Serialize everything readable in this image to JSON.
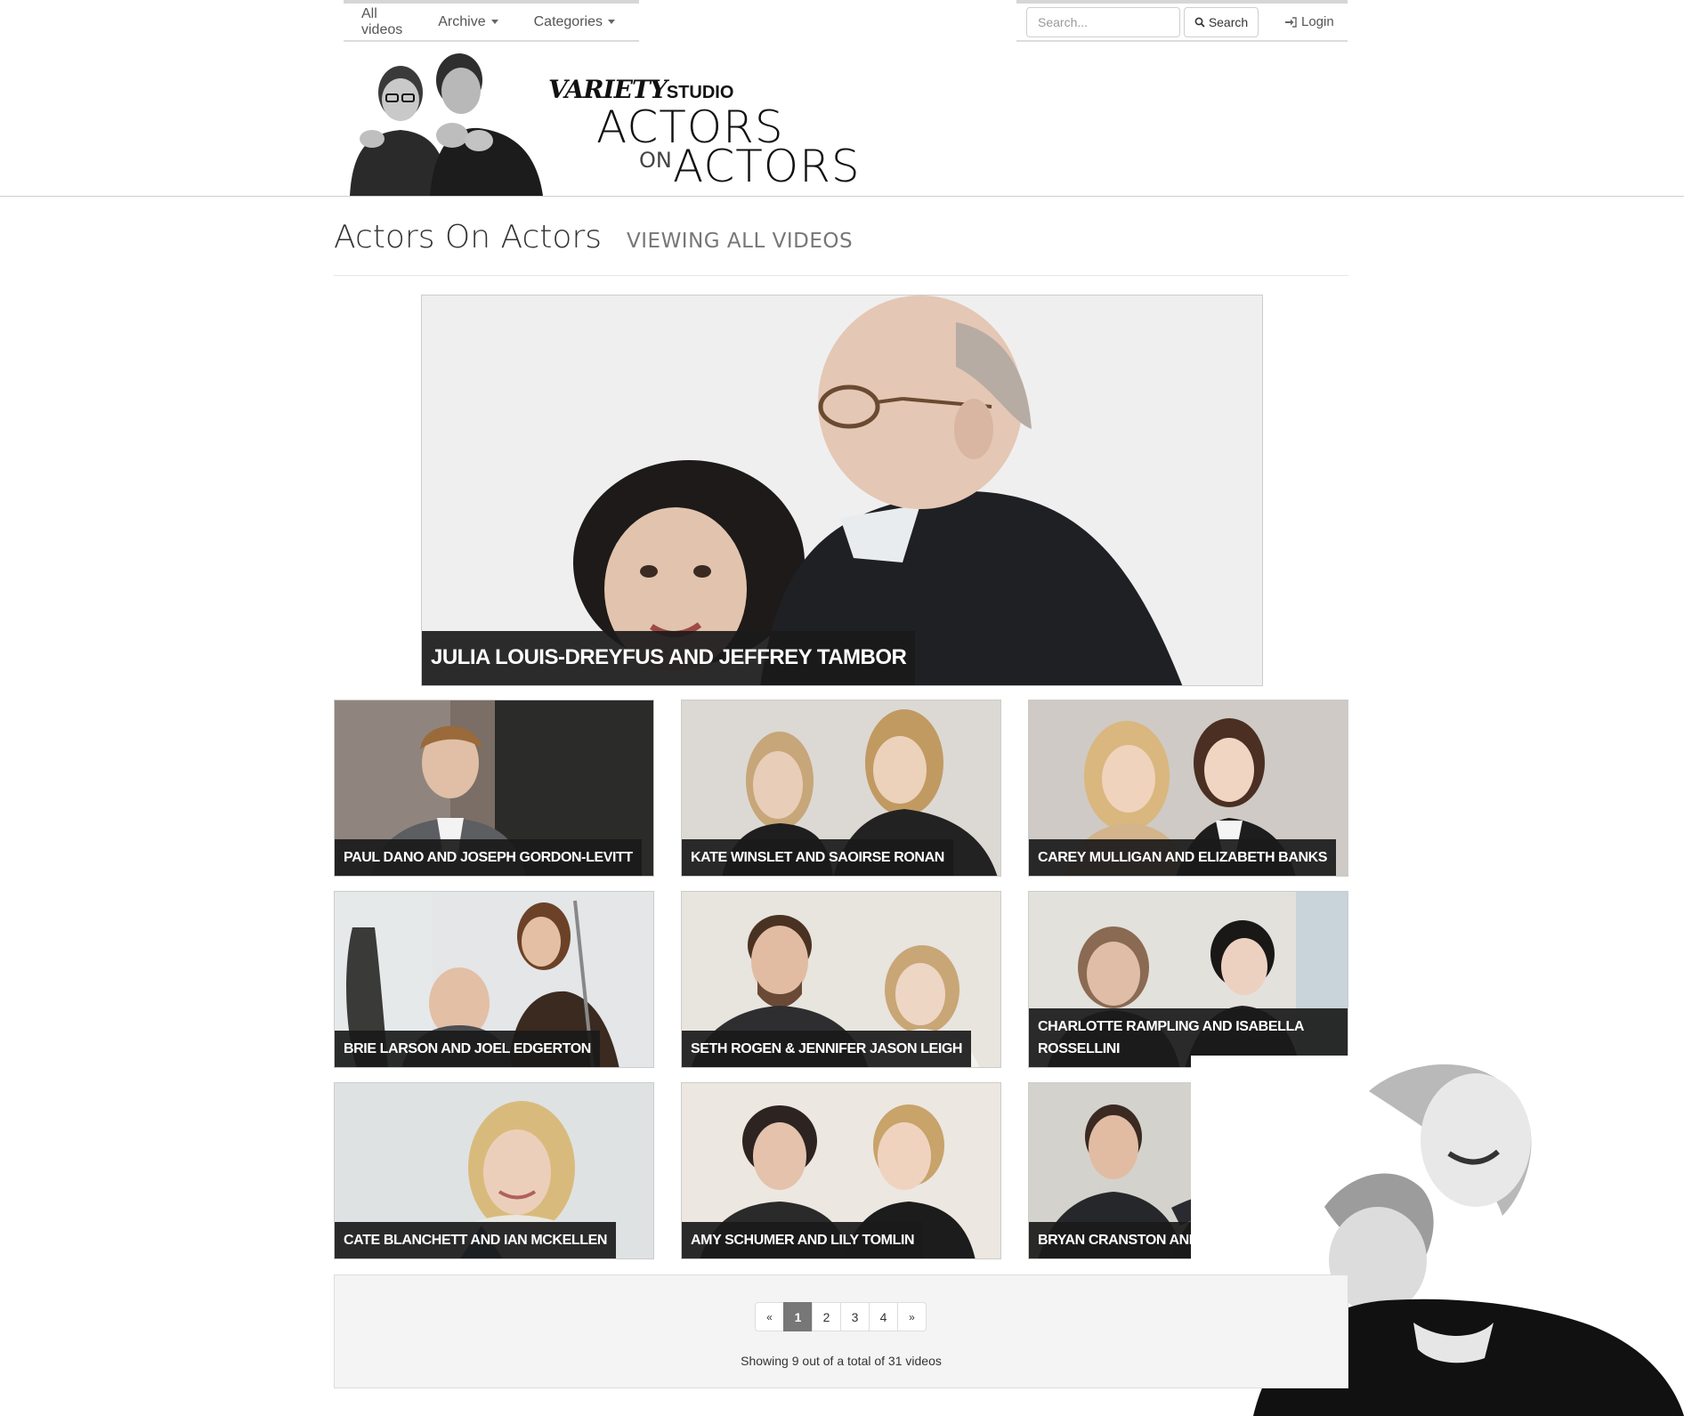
{
  "nav": {
    "all_videos": "All videos",
    "archive": "Archive",
    "categories": "Categories",
    "search_placeholder": "Search...",
    "search_button": "Search",
    "login": "Login"
  },
  "brand": {
    "variety": "VARIETY",
    "studio": "STUDIO",
    "title_line1": "ACTORS",
    "title_on": "ON",
    "title_line2": "ACTORS"
  },
  "page": {
    "title": "Actors On Actors",
    "subtitle": "VIEWING ALL VIDEOS"
  },
  "featured": {
    "caption": "JULIA LOUIS-DREYFUS AND JEFFREY TAMBOR"
  },
  "videos": [
    {
      "caption": "PAUL DANO AND JOSEPH GORDON-LEVITT"
    },
    {
      "caption": "KATE WINSLET AND SAOIRSE RONAN"
    },
    {
      "caption": "CAREY MULLIGAN AND ELIZABETH BANKS"
    },
    {
      "caption": "BRIE LARSON AND JOEL EDGERTON"
    },
    {
      "caption": "SETH ROGEN & JENNIFER JASON LEIGH"
    },
    {
      "caption": "CHARLOTTE RAMPLING AND ISABELLA ROSSELLINI"
    },
    {
      "caption": "CATE BLANCHETT AND IAN MCKELLEN"
    },
    {
      "caption": "AMY SCHUMER AND LILY TOMLIN"
    },
    {
      "caption": "BRYAN CRANSTON AND JASON SEGEL"
    }
  ],
  "pagination": {
    "prev": "«",
    "pages": [
      "1",
      "2",
      "3",
      "4"
    ],
    "active_page": "1",
    "next": "»",
    "summary": "Showing 9 out of a total of 31 videos"
  }
}
